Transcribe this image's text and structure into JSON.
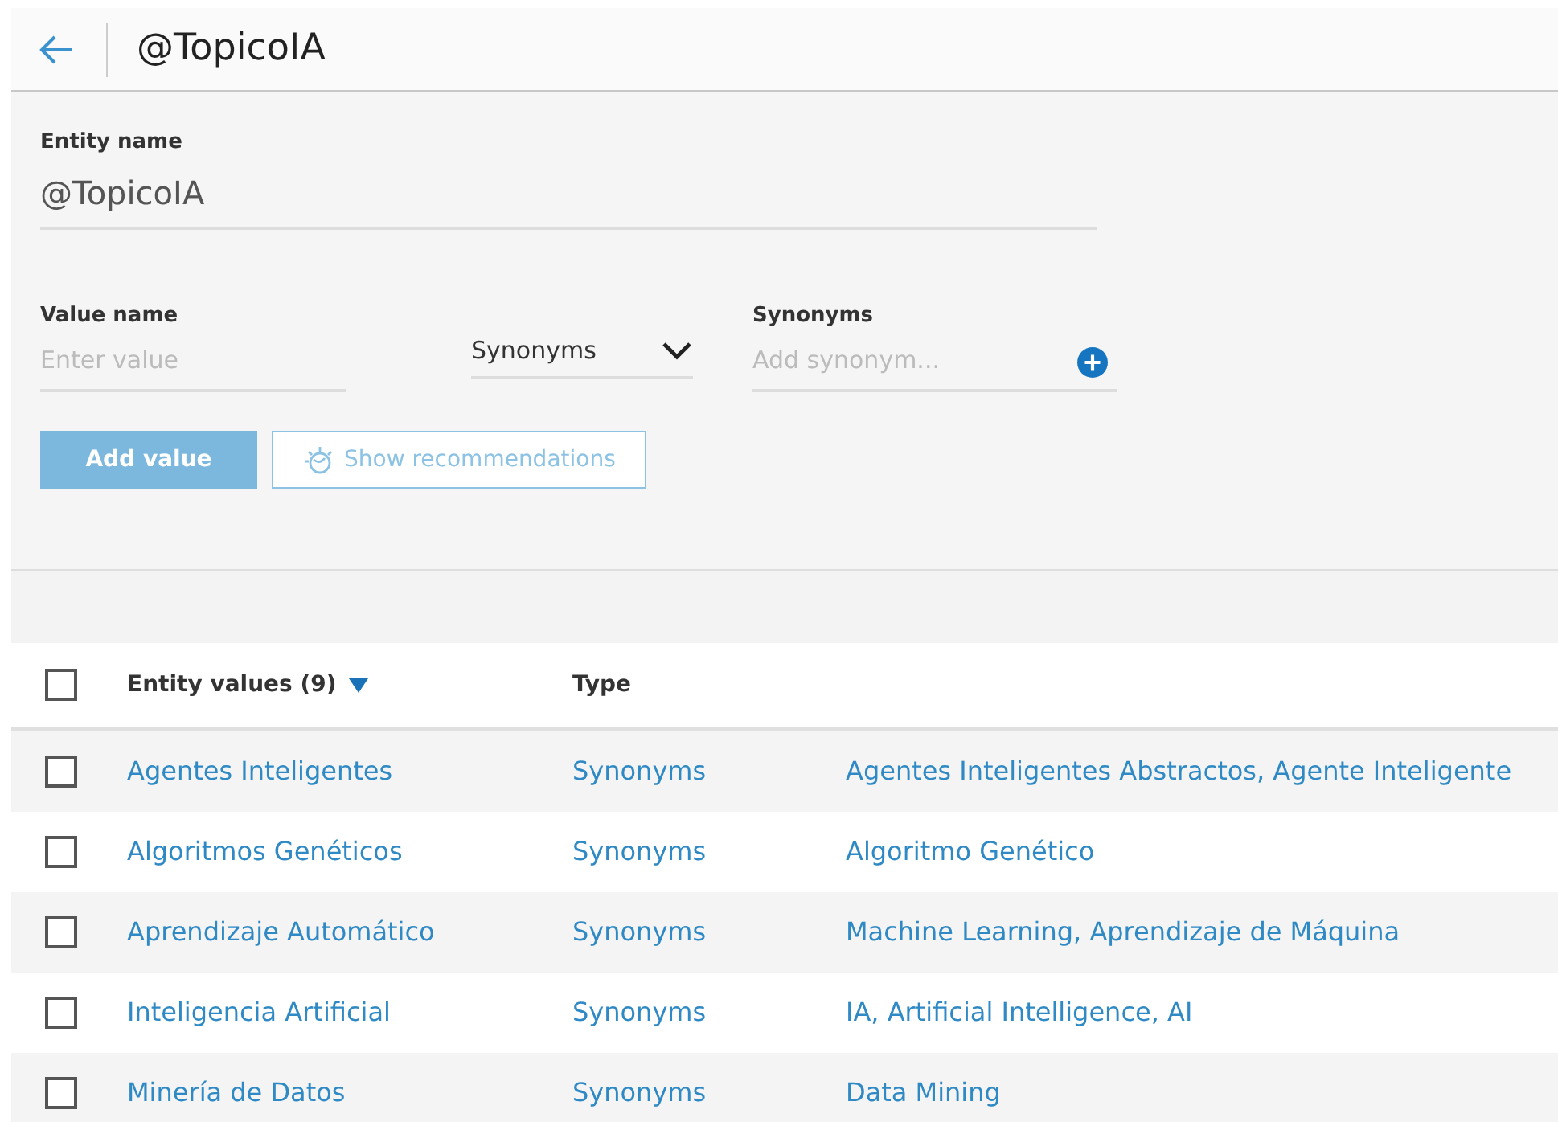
{
  "header": {
    "title": "@TopicoIA"
  },
  "entity_name": {
    "label": "Entity name",
    "value": "@TopicoIA"
  },
  "value_name": {
    "label": "Value name",
    "placeholder": "Enter value"
  },
  "type_select": {
    "value": "Synonyms"
  },
  "synonyms": {
    "label": "Synonyms",
    "placeholder": "Add synonym..."
  },
  "buttons": {
    "add_value": {
      "label": "Add value",
      "disabled": true
    },
    "recommendations": {
      "label": "Show recommendations"
    }
  },
  "table": {
    "select_all": {
      "checked": false
    },
    "columns": [
      "Entity values (9)",
      "Type"
    ],
    "rows": [
      {
        "checked": false,
        "value": "Agentes Inteligentes",
        "type": "Synonyms",
        "synonyms": "Agentes Inteligentes Abstractos, Agente Inteligente"
      },
      {
        "checked": false,
        "value": "Algoritmos Genéticos",
        "type": "Synonyms",
        "synonyms": "Algoritmo Genético"
      },
      {
        "checked": false,
        "value": "Aprendizaje Automático",
        "type": "Synonyms",
        "synonyms": "Machine Learning, Aprendizaje de Máquina"
      },
      {
        "checked": false,
        "value": "Inteligencia Artificial",
        "type": "Synonyms",
        "synonyms": "IA, Artificial Intelligence, AI"
      },
      {
        "checked": false,
        "value": "Minería de Datos",
        "type": "Synonyms",
        "synonyms": "Data Mining"
      }
    ]
  }
}
